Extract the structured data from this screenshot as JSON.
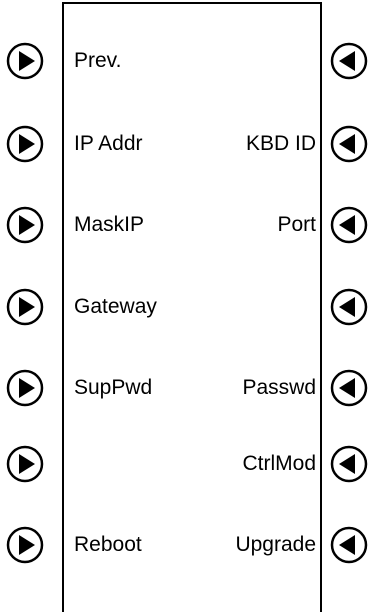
{
  "screen": {
    "rows": [
      {
        "left_label": "Prev.",
        "right_label": ""
      },
      {
        "left_label": "IP Addr",
        "right_label": "KBD ID"
      },
      {
        "left_label": "MaskIP",
        "right_label": "Port"
      },
      {
        "left_label": "Gateway",
        "right_label": ""
      },
      {
        "left_label": "SupPwd",
        "right_label": "Passwd"
      },
      {
        "left_label": "",
        "right_label": "CtrlMod"
      },
      {
        "left_label": "Reboot",
        "right_label": "Upgrade"
      }
    ]
  },
  "icons": {
    "left_softkey": "play-right-icon",
    "right_softkey": "play-left-icon"
  },
  "colors": {
    "foreground": "#000000",
    "background": "#ffffff"
  }
}
